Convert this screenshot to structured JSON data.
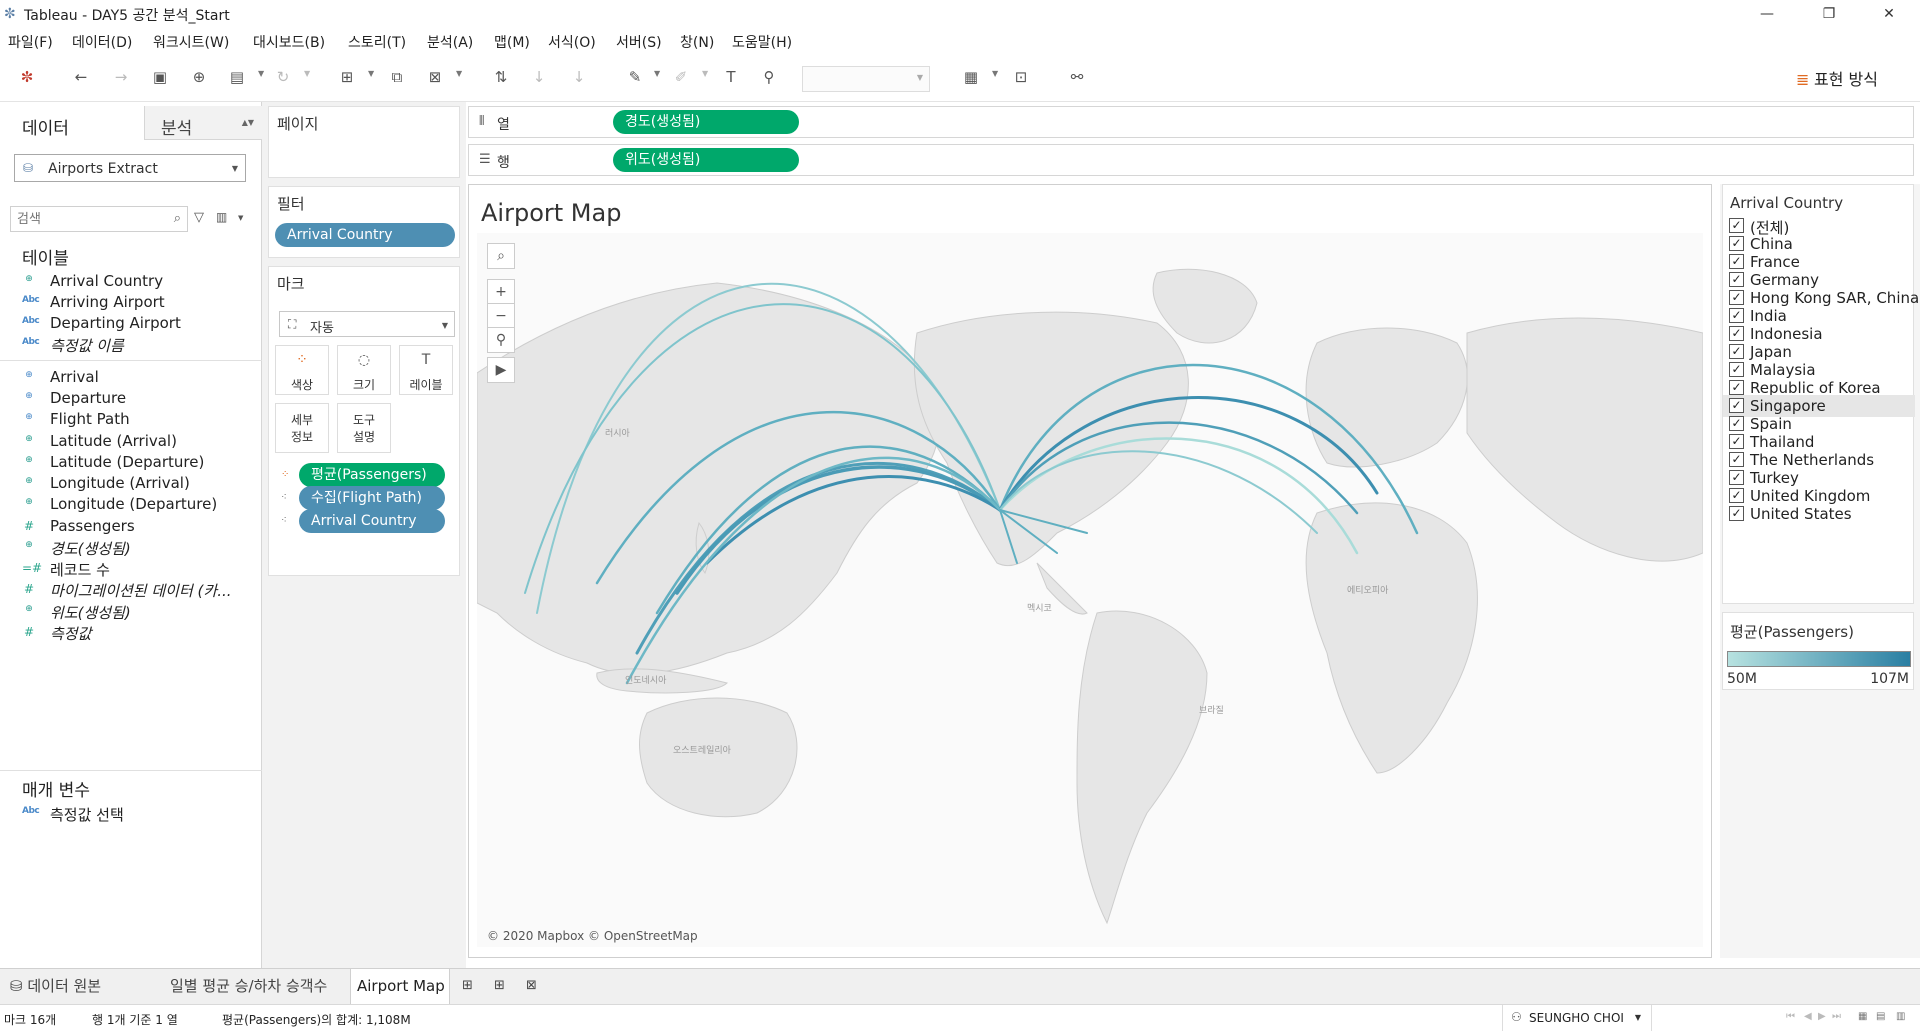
{
  "window": {
    "title": "Tableau - DAY5 공간 분석_Start"
  },
  "menu": [
    "파일(F)",
    "데이터(D)",
    "워크시트(W)",
    "대시보드(B)",
    "스토리(T)",
    "분석(A)",
    "맵(M)",
    "서식(O)",
    "서버(S)",
    "창(N)",
    "도움말(H)"
  ],
  "toolbar": {
    "show_me": "표현 방식"
  },
  "left": {
    "tab_data": "데이터",
    "tab_analysis": "분석",
    "datasource": "Airports Extract",
    "search_placeholder": "검색",
    "tables_title": "테이블",
    "dimensions": [
      {
        "icon": "globe",
        "label": "Arrival Country",
        "italic": false
      },
      {
        "icon": "abc",
        "label": "Arriving Airport",
        "italic": false
      },
      {
        "icon": "abc",
        "label": "Departing Airport",
        "italic": false
      },
      {
        "icon": "abc",
        "label": "측정값 이름",
        "italic": true
      }
    ],
    "measures": [
      {
        "icon": "geo",
        "label": "Arrival",
        "italic": false
      },
      {
        "icon": "geo",
        "label": "Departure",
        "italic": false
      },
      {
        "icon": "geo",
        "label": "Flight Path",
        "italic": false
      },
      {
        "icon": "globe",
        "label": "Latitude (Arrival)",
        "italic": false
      },
      {
        "icon": "globe",
        "label": "Latitude (Departure)",
        "italic": false
      },
      {
        "icon": "globe",
        "label": "Longitude (Arrival)",
        "italic": false
      },
      {
        "icon": "globe",
        "label": "Longitude (Departure)",
        "italic": false
      },
      {
        "icon": "hash",
        "label": "Passengers",
        "italic": false
      },
      {
        "icon": "globe",
        "label": "경도(생성됨)",
        "italic": true
      },
      {
        "icon": "hash2",
        "label": "레코드 수",
        "italic": false
      },
      {
        "icon": "hash",
        "label": "마이그레이션된 데이터 (카...",
        "italic": true
      },
      {
        "icon": "globe",
        "label": "위도(생성됨)",
        "italic": true
      },
      {
        "icon": "hash",
        "label": "측정값",
        "italic": true
      }
    ],
    "params_title": "매개 변수",
    "params": [
      {
        "icon": "abc",
        "label": "측정값 선택"
      }
    ]
  },
  "mid": {
    "pages_title": "페이지",
    "filters_title": "필터",
    "filter_pill": "Arrival Country",
    "marks_title": "마크",
    "mark_type": "자동",
    "buttons": {
      "color": "색상",
      "size": "크기",
      "label": "레이블",
      "detail": "세부\n정보",
      "tooltip": "도구\n설명"
    },
    "mark_pills": [
      "평균(Passengers)",
      "수집(Flight Path)",
      "Arrival Country"
    ]
  },
  "shelves": {
    "columns_label": "열",
    "columns_pill": "경도(생성됨)",
    "rows_label": "행",
    "rows_pill": "위도(생성됨)"
  },
  "viz": {
    "title": "Airport Map",
    "copyright": "© 2020 Mapbox © OpenStreetMap"
  },
  "legend": {
    "filter_title": "Arrival Country",
    "items": [
      {
        "label": "(전체)",
        "checked": true,
        "selected": false
      },
      {
        "label": "China",
        "checked": true,
        "selected": false
      },
      {
        "label": "France",
        "checked": true,
        "selected": false
      },
      {
        "label": "Germany",
        "checked": true,
        "selected": false
      },
      {
        "label": "Hong Kong SAR, China",
        "checked": true,
        "selected": false
      },
      {
        "label": "India",
        "checked": true,
        "selected": false
      },
      {
        "label": "Indonesia",
        "checked": true,
        "selected": false
      },
      {
        "label": "Japan",
        "checked": true,
        "selected": false
      },
      {
        "label": "Malaysia",
        "checked": true,
        "selected": false
      },
      {
        "label": "Republic of Korea",
        "checked": true,
        "selected": false
      },
      {
        "label": "Singapore",
        "checked": true,
        "selected": true
      },
      {
        "label": "Spain",
        "checked": true,
        "selected": false
      },
      {
        "label": "Thailand",
        "checked": true,
        "selected": false
      },
      {
        "label": "The Netherlands",
        "checked": true,
        "selected": false
      },
      {
        "label": "Turkey",
        "checked": true,
        "selected": false
      },
      {
        "label": "United Kingdom",
        "checked": true,
        "selected": false
      },
      {
        "label": "United States",
        "checked": true,
        "selected": false
      }
    ],
    "color_title": "평균(Passengers)",
    "color_min": "50M",
    "color_max": "107M",
    "color_low": "#b7e2e0",
    "color_high": "#2a7fa3"
  },
  "sheet_tabs": [
    "데이터 원본",
    "일별 평균 승/하차 승객수",
    "Airport Map"
  ],
  "status": {
    "marks": "마크 16개",
    "rows": "행 1개 기준 1 열",
    "sum": "평균(Passengers)의 합계: 1,108M",
    "user": "SEUNGHO CHOI"
  }
}
